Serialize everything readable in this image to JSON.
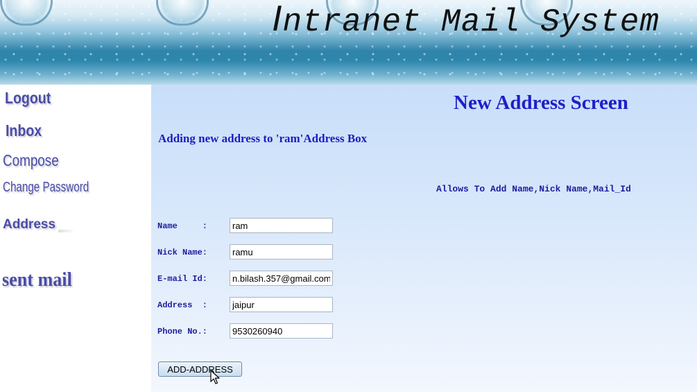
{
  "header": {
    "title_first": "I",
    "title_rest": "ntranet Mail System"
  },
  "sidebar": {
    "items": [
      {
        "label": "Logout"
      },
      {
        "label": "Inbox"
      },
      {
        "label": "Compose"
      },
      {
        "label": "Change Password"
      },
      {
        "label": "Address"
      },
      {
        "label": "sent mail"
      }
    ]
  },
  "main": {
    "title": "New Address Screen",
    "subheading": "Adding new address to 'ram'Address Box",
    "allows_text": "Allows To Add Name,Nick Name,Mail_Id",
    "fields": [
      {
        "label": "Name     :",
        "value": "ram"
      },
      {
        "label": "Nick Name:",
        "value": "ramu"
      },
      {
        "label": "E-mail Id:",
        "value": "n.bilash.357@gmail.com"
      },
      {
        "label": "Address  :",
        "value": "jaipur"
      },
      {
        "label": "Phone No.:",
        "value": "9530260940"
      }
    ],
    "submit_label": "ADD-ADDRESS"
  },
  "colors": {
    "heading_blue": "#1f1fc8",
    "nav_purple": "#4a4ca8",
    "content_bg": "#c8defa"
  },
  "icons": [
    "mouse-pointer-icon"
  ]
}
